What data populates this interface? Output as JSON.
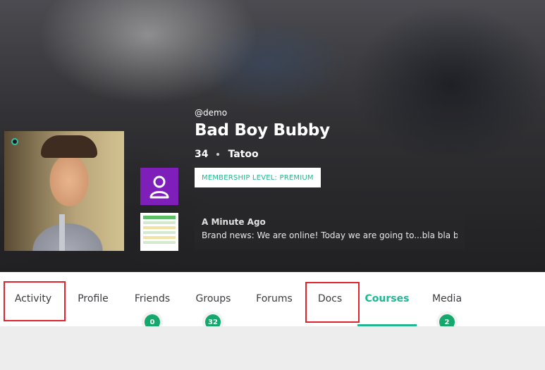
{
  "profile": {
    "handle": "@demo",
    "display_name": "Bad Boy Bubby",
    "age": "34",
    "interest": "Tatoo",
    "membership_label": "MEMBERSHIP LEVEL: PREMIUM"
  },
  "status": {
    "time": "A Minute Ago",
    "text": "Brand news: We are online! Today we are going to...bla bla bla"
  },
  "nav": {
    "tabs": [
      {
        "label": "Activity"
      },
      {
        "label": "Profile"
      },
      {
        "label": "Friends",
        "badge": "0"
      },
      {
        "label": "Groups",
        "badge": "32"
      },
      {
        "label": "Forums"
      },
      {
        "label": "Docs"
      },
      {
        "label": "Courses",
        "active": true
      },
      {
        "label": "Media",
        "badge": "2"
      }
    ]
  },
  "colors": {
    "accent": "#1fb890",
    "badge": "#14a86c",
    "group_avatar": "#7d1fb8",
    "highlight": "#e0242d"
  },
  "icons": {
    "group": "user-icon",
    "doc": "document-thumbnail",
    "online": "online-status-dot"
  }
}
